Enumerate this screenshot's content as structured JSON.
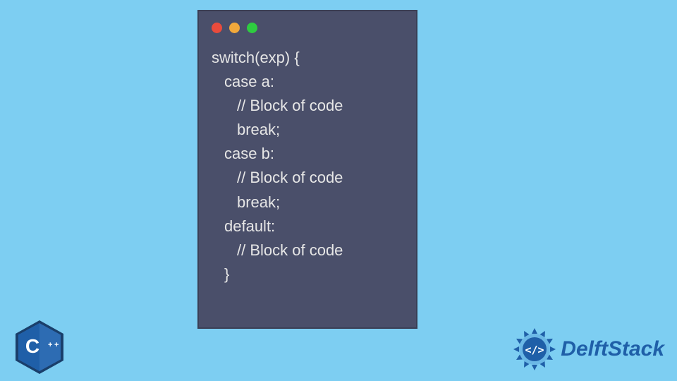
{
  "code": {
    "lines": [
      {
        "indent": "l1",
        "text": "switch(exp) {"
      },
      {
        "indent": "l2",
        "text": "case a:"
      },
      {
        "indent": "l3",
        "text": "// Block of code"
      },
      {
        "indent": "l3",
        "text": "break;"
      },
      {
        "indent": "l2",
        "text": "case b:"
      },
      {
        "indent": "l3",
        "text": "// Block of code"
      },
      {
        "indent": "l3",
        "text": "break;"
      },
      {
        "indent": "l2",
        "text": "default:"
      },
      {
        "indent": "l3",
        "text": "// Block of code"
      },
      {
        "indent": "l2",
        "text": "}"
      }
    ]
  },
  "window_dots": {
    "red": "#e94b3c",
    "yellow": "#f2a93b",
    "green": "#2ecc40"
  },
  "cpp_logo": {
    "label": "C++",
    "fill": "#1f5fa8",
    "inner": "#2d6cb3"
  },
  "brand": {
    "name": "DelftStack",
    "color": "#1f5fa8"
  }
}
